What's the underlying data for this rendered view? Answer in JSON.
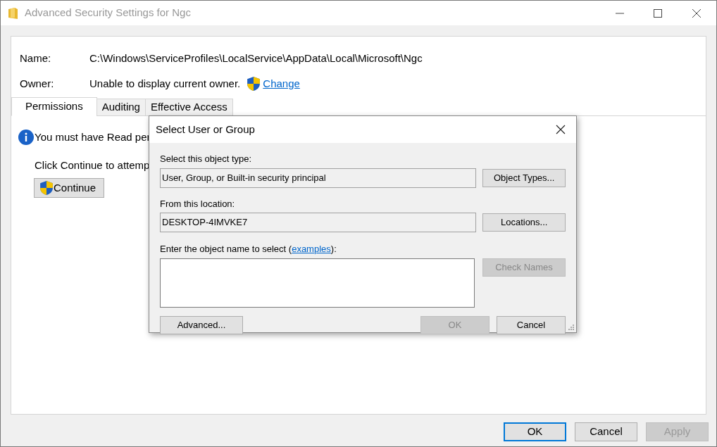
{
  "window": {
    "title": "Advanced Security Settings for Ngc"
  },
  "name": {
    "label": "Name:",
    "value": "C:\\Windows\\ServiceProfiles\\LocalService\\AppData\\Local\\Microsoft\\Ngc"
  },
  "owner": {
    "label": "Owner:",
    "value": "Unable to display current owner.",
    "link": "Change"
  },
  "tabs": [
    {
      "label": "Permissions",
      "selected": true
    },
    {
      "label": "Auditing",
      "selected": false
    },
    {
      "label": "Effective Access",
      "selected": false
    }
  ],
  "permissions_panel": {
    "info_text": "You must have Read per",
    "instruction_text": "Click Continue to attemp",
    "continue_button": "Continue"
  },
  "dialog": {
    "title": "Select User or Group",
    "object_type": {
      "label": "Select this object type:",
      "value": "User, Group, or Built-in security principal",
      "button": "Object Types..."
    },
    "location": {
      "label": "From this location:",
      "value": "DESKTOP-4IMVKE7",
      "button": "Locations..."
    },
    "object_name": {
      "label_before": "Enter the object name to select (",
      "link": "examples",
      "label_after": "):"
    },
    "side_buttons": [
      {
        "label": "Check Names",
        "disabled": true
      }
    ],
    "buttons": [
      {
        "label": "Advanced...",
        "disabled": false
      },
      {
        "label": "OK",
        "disabled": true
      },
      {
        "label": "Cancel",
        "disabled": false
      }
    ]
  },
  "buttons": [
    {
      "label": "OK",
      "disabled": false,
      "default": true
    },
    {
      "label": "Cancel",
      "disabled": false,
      "default": false
    },
    {
      "label": "Apply",
      "disabled": true,
      "default": false
    }
  ]
}
